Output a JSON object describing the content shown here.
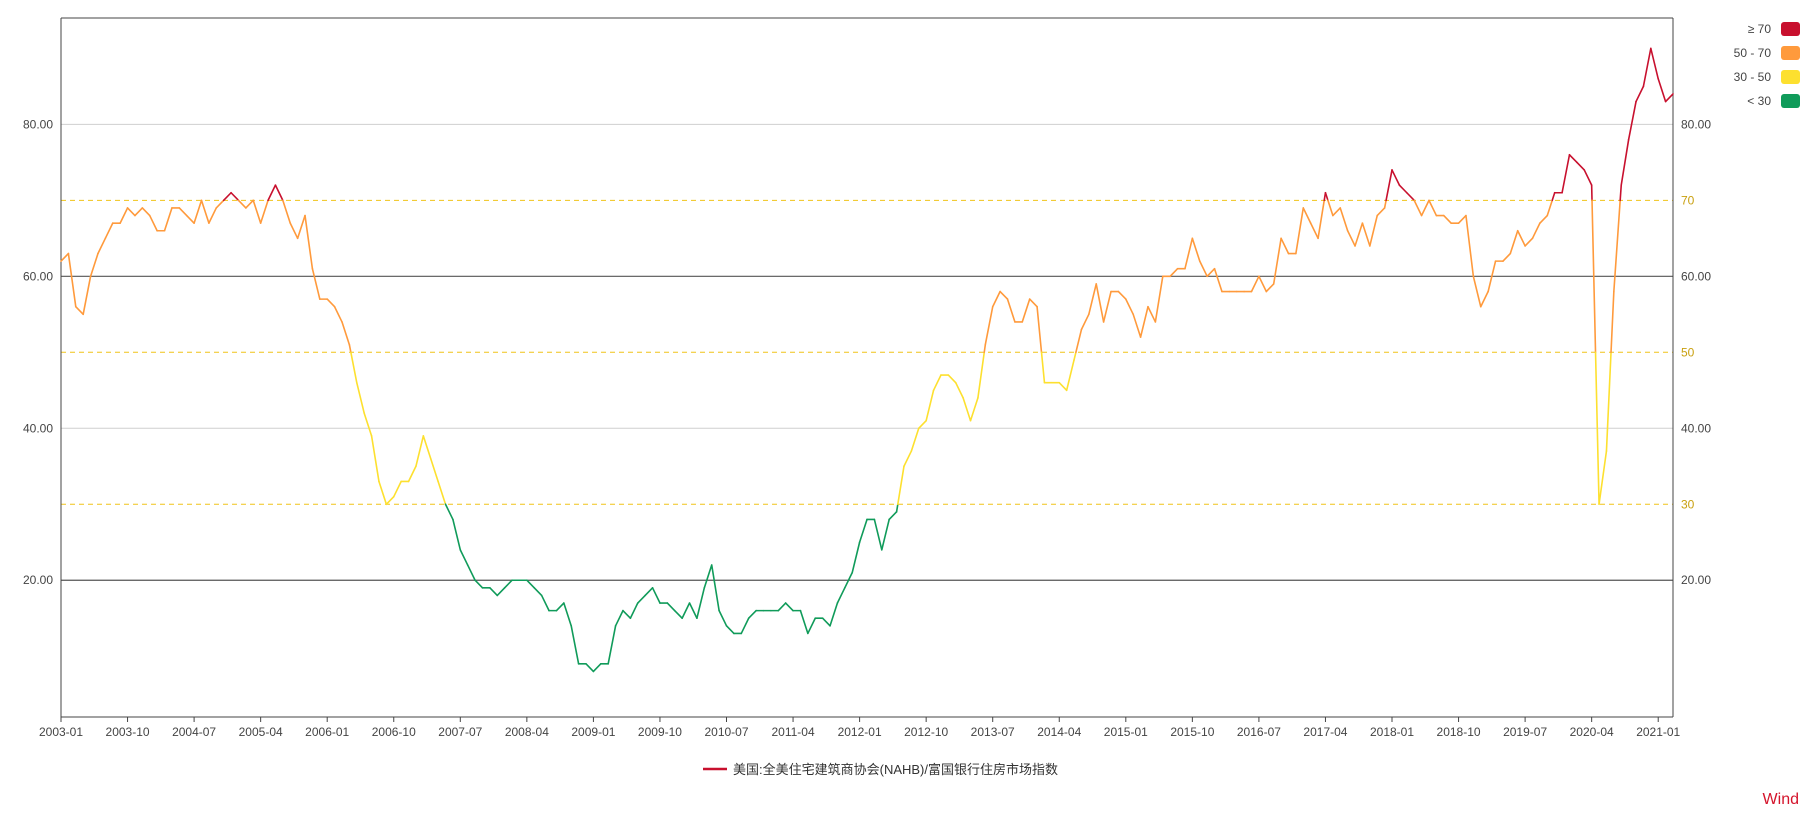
{
  "chart_data": {
    "type": "line",
    "series": [
      {
        "name": "美国:全美住宅建筑商协会(NAHB)/富国银行住房市场指数",
        "start": "2003-01",
        "values": [
          62,
          63,
          56,
          55,
          60,
          63,
          65,
          67,
          67,
          69,
          68,
          69,
          68,
          66,
          66,
          69,
          69,
          68,
          67,
          70,
          67,
          69,
          70,
          71,
          70,
          69,
          70,
          67,
          70,
          72,
          70,
          67,
          65,
          68,
          61,
          57,
          57,
          56,
          54,
          51,
          46,
          42,
          39,
          33,
          30,
          31,
          33,
          33,
          35,
          39,
          36,
          33,
          30,
          28,
          24,
          22,
          20,
          19,
          19,
          18,
          19,
          20,
          20,
          20,
          19,
          18,
          16,
          16,
          17,
          14,
          9,
          9,
          8,
          9,
          9,
          14,
          16,
          15,
          17,
          18,
          19,
          17,
          17,
          16,
          15,
          17,
          15,
          19,
          22,
          16,
          14,
          13,
          13,
          15,
          16,
          16,
          16,
          16,
          17,
          16,
          16,
          13,
          15,
          15,
          14,
          17,
          19,
          21,
          25,
          28,
          28,
          24,
          28,
          29,
          35,
          37,
          40,
          41,
          45,
          47,
          47,
          46,
          44,
          41,
          44,
          51,
          56,
          58,
          57,
          54,
          54,
          57,
          56,
          46,
          46,
          46,
          45,
          49,
          53,
          55,
          59,
          54,
          58,
          58,
          57,
          55,
          52,
          56,
          54,
          60,
          60,
          61,
          61,
          65,
          62,
          60,
          61,
          58,
          58,
          58,
          58,
          58,
          60,
          58,
          59,
          65,
          63,
          63,
          69,
          67,
          65,
          71,
          68,
          69,
          66,
          64,
          67,
          64,
          68,
          69,
          74,
          72,
          71,
          70,
          68,
          70,
          68,
          68,
          67,
          67,
          68,
          60,
          56,
          58,
          62,
          62,
          63,
          66,
          64,
          65,
          67,
          68,
          71,
          71,
          76,
          75,
          74,
          72,
          30,
          37,
          58,
          72,
          78,
          83,
          85,
          90,
          86,
          83,
          84
        ]
      }
    ],
    "x_ticks": [
      "2003-01",
      "2003-10",
      "2004-07",
      "2005-04",
      "2006-01",
      "2006-10",
      "2007-07",
      "2008-04",
      "2009-01",
      "2009-10",
      "2010-07",
      "2011-04",
      "2012-01",
      "2012-10",
      "2013-07",
      "2014-04",
      "2015-01",
      "2015-10",
      "2016-07",
      "2017-04",
      "2018-01",
      "2018-10",
      "2019-07",
      "2020-04",
      "2021-01"
    ],
    "y_ticks": [
      "20.00",
      "40.00",
      "60.00",
      "80.00"
    ],
    "ref_lines": [
      "30",
      "50",
      "70"
    ],
    "ylim": [
      2,
      94
    ],
    "legend": {
      "ranges": [
        {
          "label": "≥ 70",
          "color": "#c8102e"
        },
        {
          "label": "50 - 70",
          "color": "#ff9a3c"
        },
        {
          "label": "30 - 50",
          "color": "#fde02f"
        },
        {
          "label": "< 30",
          "color": "#109b5a"
        }
      ]
    },
    "colors": {
      "above_70": "#c8102e",
      "from_50_to_70": "#ff9a3c",
      "from_30_to_50": "#fde02f",
      "below_30": "#109b5a",
      "ref_line": "#f0c419",
      "ref_label": "#c9a010",
      "series_legend": "#c8102e"
    }
  },
  "watermark": "Wind"
}
